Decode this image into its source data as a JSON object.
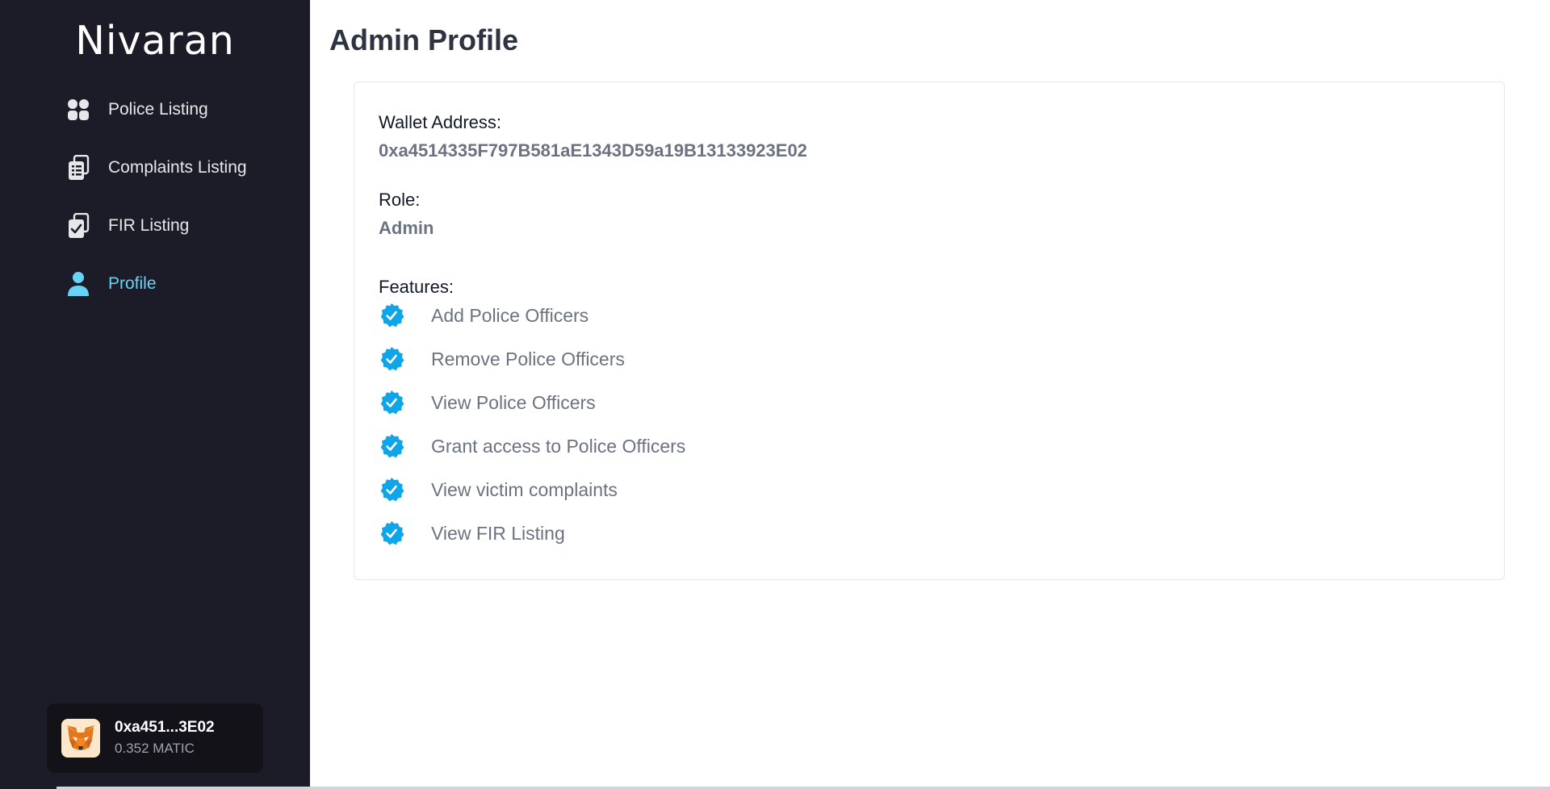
{
  "app": {
    "brand": "Nivaran"
  },
  "sidebar": {
    "items": [
      {
        "label": "Police Listing",
        "icon": "grid-icon"
      },
      {
        "label": "Complaints Listing",
        "icon": "clipboard-list-icon"
      },
      {
        "label": "FIR Listing",
        "icon": "clipboard-check-icon"
      },
      {
        "label": "Profile",
        "icon": "user-icon",
        "active": true
      }
    ]
  },
  "wallet": {
    "address": "0xa451...3E02",
    "balance": "0.352 MATIC",
    "icon": "metamask-fox-icon"
  },
  "main": {
    "title": "Admin Profile",
    "wallet_label": "Wallet Address:",
    "wallet_value": "0xa4514335F797B581aE1343D59a19B13133923E02",
    "role_label": "Role:",
    "role_value": "Admin",
    "features_label": "Features:",
    "features": [
      "Add Police Officers",
      "Remove Police Officers",
      "View Police Officers",
      "Grant access to Police Officers",
      "View victim complaints",
      "View FIR Listing"
    ]
  },
  "colors": {
    "sidebar_bg": "#1c1c28",
    "accent": "#67d4f7",
    "check": "#0ea5e9",
    "title": "#2d3340",
    "muted_text": "#6b7280"
  }
}
